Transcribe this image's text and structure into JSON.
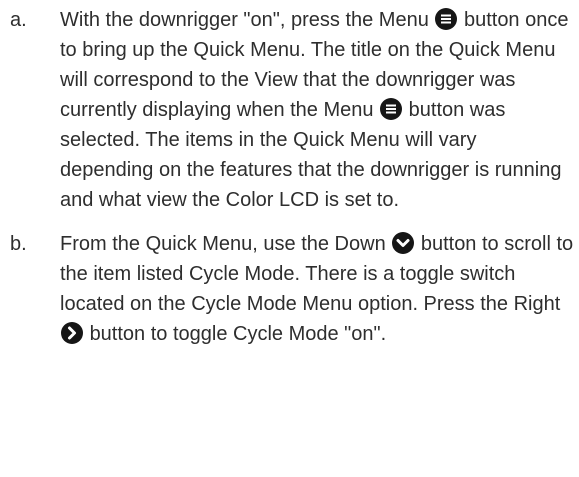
{
  "steps": [
    {
      "marker": "a.",
      "p1": "With the downrigger \"on\", press the Menu",
      "p2": "button once to bring up the Quick Menu. The title on the Quick Menu will correspond to the View that the downrigger was currently displaying when the Menu",
      "p3": "button was selected. The items in the Quick Menu will vary depending on the features that the downrigger is running and what view the Color LCD is set to.",
      "icons": [
        "menu-icon",
        "menu-icon"
      ]
    },
    {
      "marker": "b.",
      "p1": "From the Quick Menu, use the Down",
      "p2": "button to scroll to the item listed Cycle Mode. There is a toggle switch located on the Cycle Mode Menu option. Press the Right",
      "p3": "button to toggle Cycle Mode \"on\".",
      "icons": [
        "chevron-down-icon",
        "chevron-right-icon"
      ]
    }
  ]
}
